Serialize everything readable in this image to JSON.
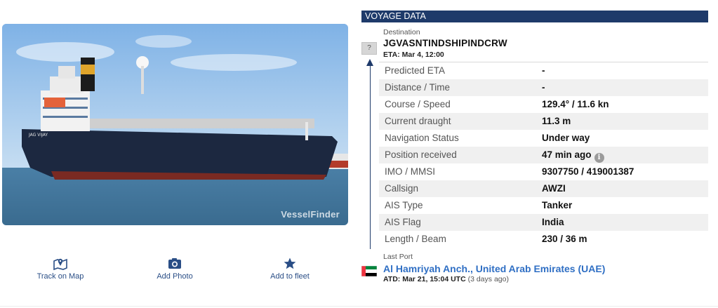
{
  "photo": {
    "watermark": "VesselFinder",
    "hull_text": "JAG VIJAY"
  },
  "actions": [
    {
      "label": "Track on Map",
      "icon": "map-pin-icon"
    },
    {
      "label": "Add Photo",
      "icon": "camera-icon"
    },
    {
      "label": "Add to fleet",
      "icon": "star-icon"
    }
  ],
  "voyage": {
    "header": "VOYAGE DATA",
    "destination_label": "Destination",
    "destination": "JGVASNTINDSHIPINDCRW",
    "eta": "ETA: Mar 4, 12:00",
    "unknown_flag": "?",
    "rows": [
      {
        "key": "Predicted ETA",
        "value": "-"
      },
      {
        "key": "Distance / Time",
        "value": "-"
      },
      {
        "key": "Course / Speed",
        "value": "129.4° / 11.6 kn"
      },
      {
        "key": "Current draught",
        "value": "11.3 m"
      },
      {
        "key": "Navigation Status",
        "value": "Under way"
      },
      {
        "key": "Position received",
        "value": "47 min ago"
      },
      {
        "key": "IMO / MMSI",
        "value": "9307750 / 419001387"
      },
      {
        "key": "Callsign",
        "value": "AWZI"
      },
      {
        "key": "AIS Type",
        "value": "Tanker"
      },
      {
        "key": "AIS Flag",
        "value": "India"
      },
      {
        "key": "Length / Beam",
        "value": "230 / 36 m"
      }
    ],
    "info_glyph": "i",
    "last_port_label": "Last Port",
    "last_port": "Al Hamriyah Anch., United Arab Emirates (UAE)",
    "atd": "ATD: Mar 21, 15:04 UTC",
    "atd_relative": "(3 days ago)"
  },
  "colors": {
    "header_bg": "#1e3a6a",
    "link": "#2f6fc4",
    "action": "#2a4e86"
  }
}
